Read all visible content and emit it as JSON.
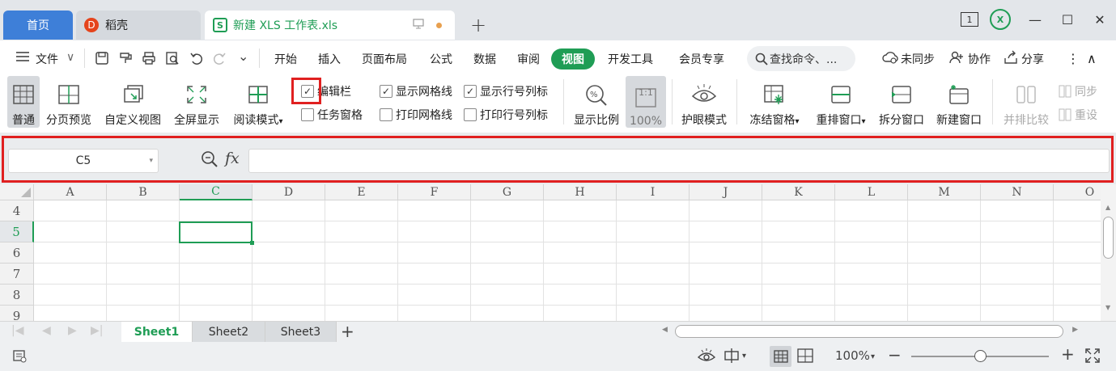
{
  "tabs": {
    "home": "首页",
    "docer": "稻壳",
    "docer_logo": "D",
    "document": "新建 XLS 工作表.xls",
    "doc_icon": "S",
    "add": "+"
  },
  "window": {
    "badge": "1",
    "excel_logo": "X",
    "minimize": "—",
    "maximize": "☐",
    "close": "✕"
  },
  "menu": {
    "file": "文件",
    "file_caret": "∨",
    "quick_caret": "⌄",
    "items": [
      "开始",
      "插入",
      "页面布局",
      "公式",
      "数据",
      "审阅",
      "视图",
      "开发工具",
      "会员专享"
    ],
    "search": "查找命令、...",
    "sync": "未同步",
    "collab": "协作",
    "share": "分享",
    "more": "⋮",
    "collapse": "∧"
  },
  "ribbon": {
    "normal": "普通",
    "page_break": "分页预览",
    "custom_view": "自定义视图",
    "fullscreen": "全屏显示",
    "reading_mode": "阅读模式",
    "reading_caret": "▾",
    "cb_formula_bar": "编辑栏",
    "cb_task_pane": "任务窗格",
    "cb_gridlines": "显示网格线",
    "cb_print_gridlines": "打印网格线",
    "cb_headings": "显示行号列标",
    "cb_print_headings": "打印行号列标",
    "check_mark": "✓",
    "zoom": "显示比例",
    "zoom_100": "100%",
    "zoom_100_icon": "1:1",
    "eye_mode": "护眼模式",
    "freeze": "冻结窗格",
    "arrange": "重排窗口",
    "split": "拆分窗口",
    "new_window": "新建窗口",
    "compare": "并排比较",
    "sync_scroll": "同步",
    "reset": "重设",
    "dropdown_caret": "▾"
  },
  "formula_bar": {
    "name_box": "C5",
    "name_caret": "▾",
    "fx": "fx",
    "value": ""
  },
  "grid": {
    "columns": [
      "A",
      "B",
      "C",
      "D",
      "E",
      "F",
      "G",
      "H",
      "I",
      "J",
      "K",
      "L",
      "M",
      "N",
      "O"
    ],
    "rows": [
      "4",
      "5",
      "6",
      "7",
      "8",
      "9"
    ],
    "active_col": "C",
    "active_row": "5"
  },
  "scroll": {
    "up": "▲",
    "down": "▼",
    "left": "◀",
    "right": "▶"
  },
  "sheets": {
    "tabs": [
      "Sheet1",
      "Sheet2",
      "Sheet3"
    ],
    "active": "Sheet1",
    "add": "+",
    "nav": [
      "|◀",
      "◀",
      "▶",
      "▶|"
    ]
  },
  "status": {
    "zoom": "100%",
    "zoom_caret": "▾",
    "zoom_minus": "−",
    "zoom_plus": "+",
    "zoom_level": 0.5
  },
  "colors": {
    "accent": "#1f9d55",
    "tab_home": "#3e7fd8",
    "highlight": "#e02020"
  }
}
